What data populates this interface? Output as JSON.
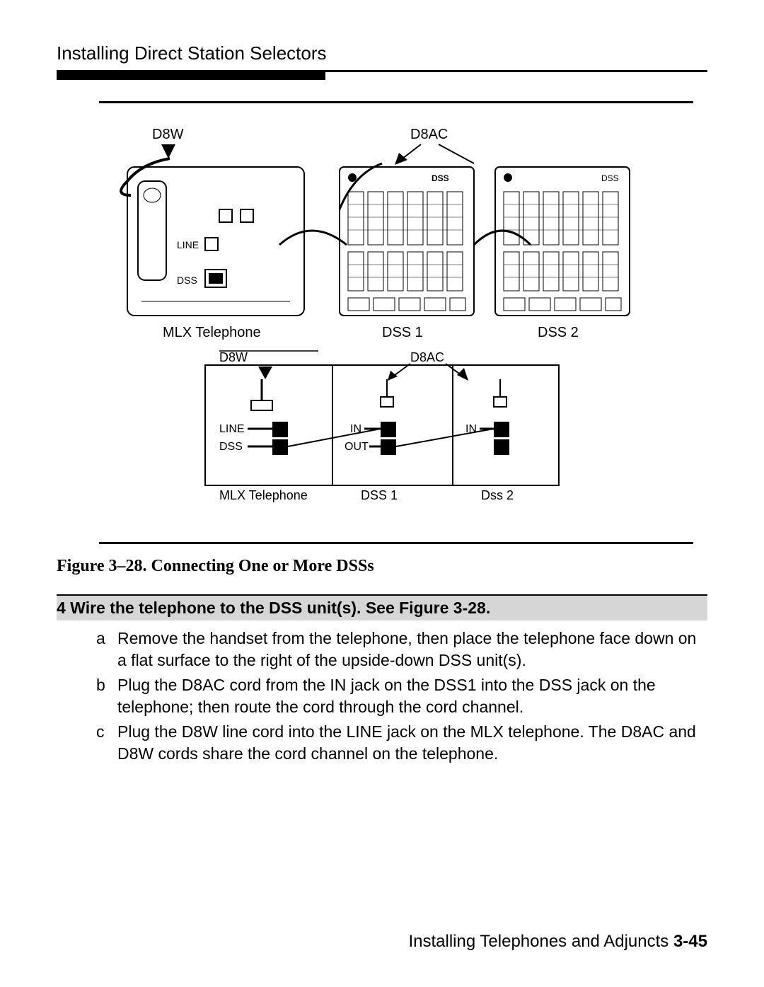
{
  "header": {
    "section_title": "Installing Direct Station Selectors"
  },
  "figure": {
    "labels": {
      "d8w": "D8W",
      "d8ac": "D8AC",
      "mlx_phone": "MLX  Telephone",
      "dss1": "DSS 1",
      "dss2": "DSS 2",
      "line": "LINE",
      "dss": "DSS",
      "in": "IN",
      "out": "OUT",
      "mlx_phone2": "MLX Telephone",
      "dss1_b": "DSS 1",
      "dss2_b": "Dss 2",
      "dss_small": "DSS"
    },
    "caption": "Figure 3–28. Connecting One or More DSSs"
  },
  "step": {
    "heading": "4 Wire the telephone to the DSS unit(s). See Figure 3-28.",
    "items": [
      {
        "letter": "a",
        "text": "Remove the handset from the telephone, then place the telephone face down on a flat surface to the right of the upside-down DSS unit(s)."
      },
      {
        "letter": "b",
        "text": "Plug the D8AC cord from the IN jack on the DSS1 into the DSS jack on the telephone; then route the cord through the cord channel."
      },
      {
        "letter": "c",
        "text": "Plug the D8W line cord into the LINE jack on the MLX telephone. The D8AC and D8W cords share the cord channel on the telephone."
      }
    ]
  },
  "footer": {
    "chapter": "Installing Telephones and Adjuncts",
    "page": "3-45"
  }
}
